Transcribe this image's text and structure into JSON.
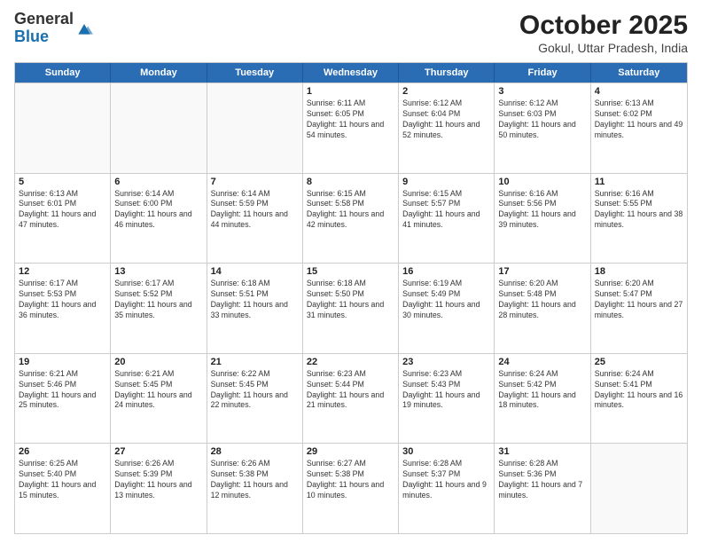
{
  "header": {
    "logo_general": "General",
    "logo_blue": "Blue",
    "month_title": "October 2025",
    "location": "Gokul, Uttar Pradesh, India"
  },
  "weekdays": [
    "Sunday",
    "Monday",
    "Tuesday",
    "Wednesday",
    "Thursday",
    "Friday",
    "Saturday"
  ],
  "rows": [
    [
      {
        "day": "",
        "sunrise": "",
        "sunset": "",
        "daylight": ""
      },
      {
        "day": "",
        "sunrise": "",
        "sunset": "",
        "daylight": ""
      },
      {
        "day": "",
        "sunrise": "",
        "sunset": "",
        "daylight": ""
      },
      {
        "day": "1",
        "sunrise": "Sunrise: 6:11 AM",
        "sunset": "Sunset: 6:05 PM",
        "daylight": "Daylight: 11 hours and 54 minutes."
      },
      {
        "day": "2",
        "sunrise": "Sunrise: 6:12 AM",
        "sunset": "Sunset: 6:04 PM",
        "daylight": "Daylight: 11 hours and 52 minutes."
      },
      {
        "day": "3",
        "sunrise": "Sunrise: 6:12 AM",
        "sunset": "Sunset: 6:03 PM",
        "daylight": "Daylight: 11 hours and 50 minutes."
      },
      {
        "day": "4",
        "sunrise": "Sunrise: 6:13 AM",
        "sunset": "Sunset: 6:02 PM",
        "daylight": "Daylight: 11 hours and 49 minutes."
      }
    ],
    [
      {
        "day": "5",
        "sunrise": "Sunrise: 6:13 AM",
        "sunset": "Sunset: 6:01 PM",
        "daylight": "Daylight: 11 hours and 47 minutes."
      },
      {
        "day": "6",
        "sunrise": "Sunrise: 6:14 AM",
        "sunset": "Sunset: 6:00 PM",
        "daylight": "Daylight: 11 hours and 46 minutes."
      },
      {
        "day": "7",
        "sunrise": "Sunrise: 6:14 AM",
        "sunset": "Sunset: 5:59 PM",
        "daylight": "Daylight: 11 hours and 44 minutes."
      },
      {
        "day": "8",
        "sunrise": "Sunrise: 6:15 AM",
        "sunset": "Sunset: 5:58 PM",
        "daylight": "Daylight: 11 hours and 42 minutes."
      },
      {
        "day": "9",
        "sunrise": "Sunrise: 6:15 AM",
        "sunset": "Sunset: 5:57 PM",
        "daylight": "Daylight: 11 hours and 41 minutes."
      },
      {
        "day": "10",
        "sunrise": "Sunrise: 6:16 AM",
        "sunset": "Sunset: 5:56 PM",
        "daylight": "Daylight: 11 hours and 39 minutes."
      },
      {
        "day": "11",
        "sunrise": "Sunrise: 6:16 AM",
        "sunset": "Sunset: 5:55 PM",
        "daylight": "Daylight: 11 hours and 38 minutes."
      }
    ],
    [
      {
        "day": "12",
        "sunrise": "Sunrise: 6:17 AM",
        "sunset": "Sunset: 5:53 PM",
        "daylight": "Daylight: 11 hours and 36 minutes."
      },
      {
        "day": "13",
        "sunrise": "Sunrise: 6:17 AM",
        "sunset": "Sunset: 5:52 PM",
        "daylight": "Daylight: 11 hours and 35 minutes."
      },
      {
        "day": "14",
        "sunrise": "Sunrise: 6:18 AM",
        "sunset": "Sunset: 5:51 PM",
        "daylight": "Daylight: 11 hours and 33 minutes."
      },
      {
        "day": "15",
        "sunrise": "Sunrise: 6:18 AM",
        "sunset": "Sunset: 5:50 PM",
        "daylight": "Daylight: 11 hours and 31 minutes."
      },
      {
        "day": "16",
        "sunrise": "Sunrise: 6:19 AM",
        "sunset": "Sunset: 5:49 PM",
        "daylight": "Daylight: 11 hours and 30 minutes."
      },
      {
        "day": "17",
        "sunrise": "Sunrise: 6:20 AM",
        "sunset": "Sunset: 5:48 PM",
        "daylight": "Daylight: 11 hours and 28 minutes."
      },
      {
        "day": "18",
        "sunrise": "Sunrise: 6:20 AM",
        "sunset": "Sunset: 5:47 PM",
        "daylight": "Daylight: 11 hours and 27 minutes."
      }
    ],
    [
      {
        "day": "19",
        "sunrise": "Sunrise: 6:21 AM",
        "sunset": "Sunset: 5:46 PM",
        "daylight": "Daylight: 11 hours and 25 minutes."
      },
      {
        "day": "20",
        "sunrise": "Sunrise: 6:21 AM",
        "sunset": "Sunset: 5:45 PM",
        "daylight": "Daylight: 11 hours and 24 minutes."
      },
      {
        "day": "21",
        "sunrise": "Sunrise: 6:22 AM",
        "sunset": "Sunset: 5:45 PM",
        "daylight": "Daylight: 11 hours and 22 minutes."
      },
      {
        "day": "22",
        "sunrise": "Sunrise: 6:23 AM",
        "sunset": "Sunset: 5:44 PM",
        "daylight": "Daylight: 11 hours and 21 minutes."
      },
      {
        "day": "23",
        "sunrise": "Sunrise: 6:23 AM",
        "sunset": "Sunset: 5:43 PM",
        "daylight": "Daylight: 11 hours and 19 minutes."
      },
      {
        "day": "24",
        "sunrise": "Sunrise: 6:24 AM",
        "sunset": "Sunset: 5:42 PM",
        "daylight": "Daylight: 11 hours and 18 minutes."
      },
      {
        "day": "25",
        "sunrise": "Sunrise: 6:24 AM",
        "sunset": "Sunset: 5:41 PM",
        "daylight": "Daylight: 11 hours and 16 minutes."
      }
    ],
    [
      {
        "day": "26",
        "sunrise": "Sunrise: 6:25 AM",
        "sunset": "Sunset: 5:40 PM",
        "daylight": "Daylight: 11 hours and 15 minutes."
      },
      {
        "day": "27",
        "sunrise": "Sunrise: 6:26 AM",
        "sunset": "Sunset: 5:39 PM",
        "daylight": "Daylight: 11 hours and 13 minutes."
      },
      {
        "day": "28",
        "sunrise": "Sunrise: 6:26 AM",
        "sunset": "Sunset: 5:38 PM",
        "daylight": "Daylight: 11 hours and 12 minutes."
      },
      {
        "day": "29",
        "sunrise": "Sunrise: 6:27 AM",
        "sunset": "Sunset: 5:38 PM",
        "daylight": "Daylight: 11 hours and 10 minutes."
      },
      {
        "day": "30",
        "sunrise": "Sunrise: 6:28 AM",
        "sunset": "Sunset: 5:37 PM",
        "daylight": "Daylight: 11 hours and 9 minutes."
      },
      {
        "day": "31",
        "sunrise": "Sunrise: 6:28 AM",
        "sunset": "Sunset: 5:36 PM",
        "daylight": "Daylight: 11 hours and 7 minutes."
      },
      {
        "day": "",
        "sunrise": "",
        "sunset": "",
        "daylight": ""
      }
    ]
  ]
}
